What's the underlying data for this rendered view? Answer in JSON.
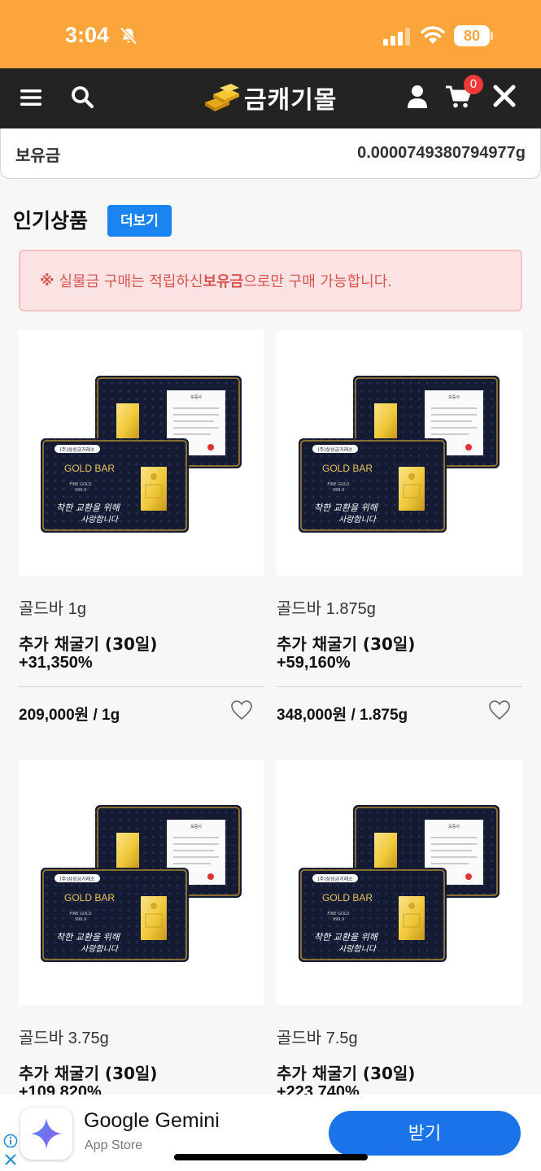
{
  "status_bar": {
    "time": "3:04",
    "battery": "80"
  },
  "nav": {
    "logo_text": "금캐기몰",
    "cart_count": "0"
  },
  "holdings": {
    "label": "보유금",
    "value": "0.0000749380794977g"
  },
  "section": {
    "title": "인기상품",
    "more_label": "더보기"
  },
  "notice": {
    "mark": "※",
    "prefix": "실물금 구매는 적립하신 ",
    "highlight": "보유금",
    "suffix": "으로만 구매 가능합니다."
  },
  "products": [
    {
      "name": "골드바 1g",
      "subtitle": "추가 채굴기 (30일)",
      "percent": "+31,350%",
      "price": "209,000원 / 1g"
    },
    {
      "name": "골드바 1.875g",
      "subtitle": "추가 채굴기 (30일)",
      "percent": "+59,160%",
      "price": "348,000원 / 1.875g"
    },
    {
      "name": "골드바 3.75g",
      "subtitle": "추가 채굴기 (30일)",
      "percent": "+109,820%",
      "price": ""
    },
    {
      "name": "골드바 7.5g",
      "subtitle": "추가 채굴기 (30일)",
      "percent": "+223,740%",
      "price": ""
    }
  ],
  "product_image": {
    "brand": "GOLD BAR",
    "company": "(주)삼성금거래소",
    "grade": "FINE GOLD",
    "purity": "999.9",
    "cert_title": "보증서",
    "slogan_1": "착한 교환을 위해",
    "slogan_2": "사랑합니다"
  },
  "ad": {
    "title": "Google Gemini",
    "store": "App Store",
    "button": "받기"
  },
  "colors": {
    "status_bar": "#fba53a",
    "nav_bar": "#232323",
    "accent_blue": "#1a84f0",
    "notice_bg": "#fbe3e4",
    "notice_text": "#d9534f",
    "gold": "#f0c93a",
    "card_navy": "#141b33"
  }
}
